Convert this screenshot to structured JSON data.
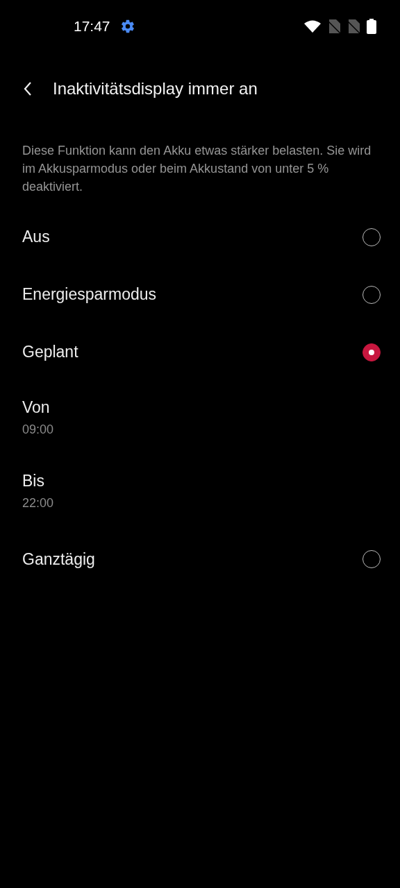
{
  "status_bar": {
    "time": "17:47"
  },
  "header": {
    "title": "Inaktivitätsdisplay immer an"
  },
  "description": "Diese Funktion kann den Akku etwas stärker belasten. Sie wird im Akkusparmodus oder beim Akkustand von unter 5 % deaktiviert.",
  "options": [
    {
      "kind": "radio",
      "label": "Aus",
      "selected": false
    },
    {
      "kind": "radio",
      "label": "Energiesparmodus",
      "selected": false
    },
    {
      "kind": "radio",
      "label": "Geplant",
      "selected": true
    },
    {
      "kind": "time",
      "label": "Von",
      "value": "09:00"
    },
    {
      "kind": "time",
      "label": "Bis",
      "value": "22:00"
    },
    {
      "kind": "radio",
      "label": "Ganztägig",
      "selected": false
    }
  ]
}
